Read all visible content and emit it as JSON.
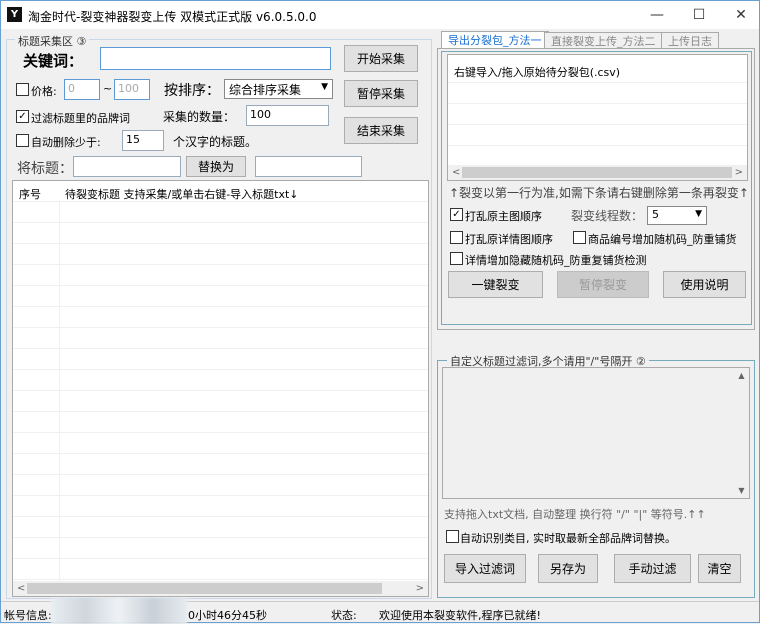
{
  "window": {
    "title": "淘金时代-裂变神器裂变上传 双模式正式版 v6.0.5.0.0",
    "minimize": "—",
    "maximize": "☐",
    "close": "✕"
  },
  "left": {
    "group_label": "标题采集区 ③",
    "keyword_label": "关键词：",
    "keyword_value": "",
    "start_button": "开始采集",
    "pause_button": "暂停采集",
    "stop_button": "结束采集",
    "price_label": "价格:",
    "price_checked": false,
    "price_min": "0",
    "price_sep": "~",
    "price_max": "100",
    "sort_label": "按排序：",
    "sort_value": "综合排序采集",
    "filter_brand_label": "过滤标题里的品牌词",
    "filter_brand_checked": true,
    "count_label": "采集的数量：",
    "count_value": "100",
    "auto_delete_label": "自动删除少于:",
    "auto_delete_checked": false,
    "auto_delete_value": "15",
    "auto_delete_suffix": "个汉字的标题。",
    "replace_label": "将标题：",
    "replace_from": "",
    "replace_button": "替换为",
    "replace_to": "",
    "table": {
      "columns": [
        "序号",
        "待裂变标题  支持采集/或单击右键-导入标题txt↓"
      ],
      "rows": []
    }
  },
  "right": {
    "tabs": [
      "导出分裂包_方法一",
      "直接裂变上传_方法二",
      "上传日志"
    ],
    "active_tab": 0,
    "list_header": "右键导入/拖入原始待分裂包(.csv)",
    "hint": "↑裂变以第一行为准,如需下条请右键删除第一条再裂变↑",
    "shuffle_main_label": "打乱原主图顺序",
    "shuffle_main_checked": true,
    "threads_label": "裂变线程数：",
    "threads_value": "5",
    "shuffle_detail_label": "打乱原详情图顺序",
    "shuffle_detail_checked": false,
    "random_code_label": "商品编号增加随机码_防重铺货",
    "random_code_checked": false,
    "hidden_code_label": "详情增加隐藏随机码_防重复铺货检测",
    "hidden_code_checked": false,
    "split_button": "一键裂变",
    "pause_split_button": "暂停裂变",
    "help_button": "使用说明",
    "filter_group_label": "自定义标题过滤词,多个请用\"/\"号隔开 ②",
    "filter_text": "",
    "filter_hint": "支持拖入txt文档, 自动整理 换行符 \"/\"  \"|\"  等符号.↑↑",
    "auto_category_label": "自动识别类目, 实时取最新全部品牌词替换。",
    "auto_category_checked": false,
    "import_button": "导入过滤词",
    "save_as_button": "另存为",
    "manual_filter_button": "手动过滤",
    "clear_button": "清空"
  },
  "status": {
    "account_label": "帐号信息:",
    "time_remaining": "0小时46分45秒",
    "state_label": "状态:",
    "message": "欢迎使用本裂变软件,程序已就绪!"
  }
}
